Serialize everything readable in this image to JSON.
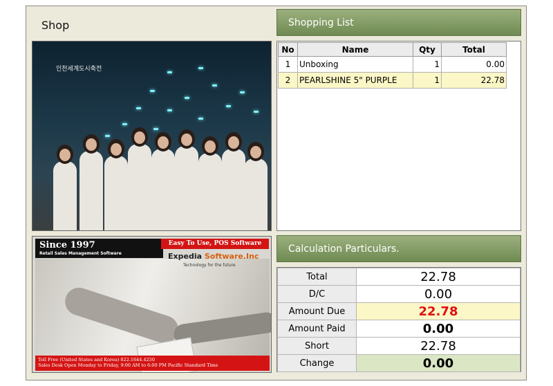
{
  "shop": {
    "title": "Shop"
  },
  "video": {
    "caption": "인천세계도시축전"
  },
  "ad": {
    "since": "Since 1997",
    "tagline": "Retail Sales Management Software",
    "easy": "Easy To Use, POS Software",
    "brand_a": "Expedia ",
    "brand_b": "Software.Inc",
    "tech": "Technology for the future",
    "footer1": "Toll Free (United States and Korea) 822.1644.4250",
    "footer2": "Sales Desk Open Monday to Friday, 9:00 AM to 6:00 PM Pacific Standard Time"
  },
  "shopping_list": {
    "header": "Shopping List",
    "columns": {
      "no": "No",
      "name": "Name",
      "qty": "Qty",
      "total": "Total"
    },
    "rows": [
      {
        "no": "1",
        "name": "Unboxing",
        "qty": "1",
        "total": "0.00"
      },
      {
        "no": "2",
        "name": "PEARLSHINE 5\" PURPLE",
        "qty": "1",
        "total": "22.78"
      }
    ]
  },
  "calculation": {
    "header": "Calculation Particulars.",
    "total_label": "Total",
    "total_value": "22.78",
    "dc_label": "D/C",
    "dc_value": "0.00",
    "due_label": "Amount Due",
    "due_value": "22.78",
    "paid_label": "Amount Paid",
    "paid_value": "0.00",
    "short_label": "Short",
    "short_value": "22.78",
    "change_label": "Change",
    "change_value": "0.00"
  },
  "colors": {
    "header_green": "#7d9760",
    "highlight_yellow": "#fbf7c6",
    "amount_due_red": "#e01010",
    "change_green": "#dbe6c5"
  }
}
